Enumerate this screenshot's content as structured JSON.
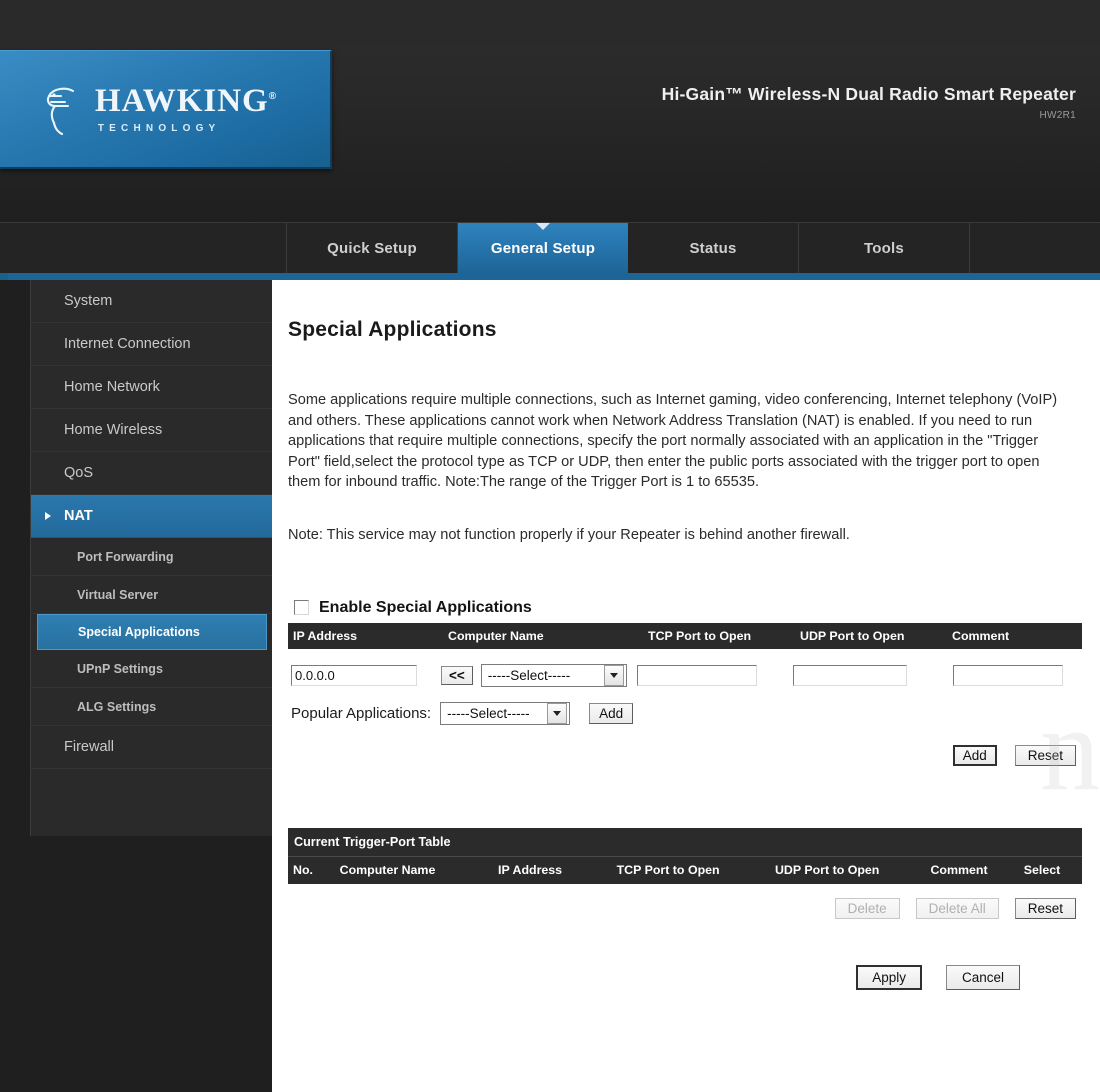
{
  "header": {
    "brand_word": "HAWKING",
    "brand_reg": "®",
    "brand_sub": "TECHNOLOGY",
    "product_title": "Hi-Gain™ Wireless-N Dual Radio Smart Repeater",
    "model": "HW2R1",
    "accent_color": "#1d6596",
    "logo_blue": "#2b7cb4"
  },
  "nav": {
    "tabs": [
      {
        "label": "Quick Setup",
        "active": false
      },
      {
        "label": "General Setup",
        "active": true
      },
      {
        "label": "Status",
        "active": false
      },
      {
        "label": "Tools",
        "active": false
      }
    ]
  },
  "sidebar": {
    "items": [
      {
        "label": "System",
        "active": false
      },
      {
        "label": "Internet Connection",
        "active": false
      },
      {
        "label": "Home Network",
        "active": false
      },
      {
        "label": "Home Wireless",
        "active": false
      },
      {
        "label": "QoS",
        "active": false
      },
      {
        "label": "NAT",
        "active": true
      }
    ],
    "sub_items": [
      {
        "label": "Port Forwarding",
        "active": false
      },
      {
        "label": "Virtual Server",
        "active": false
      },
      {
        "label": "Special Applications",
        "active": true
      },
      {
        "label": "UPnP Settings",
        "active": false
      },
      {
        "label": "ALG Settings",
        "active": false
      }
    ],
    "items_after": [
      {
        "label": "Firewall",
        "active": false
      }
    ]
  },
  "main": {
    "title": "Special Applications",
    "description": "Some applications require multiple connections, such as Internet gaming, video conferencing, Internet telephony (VoIP) and others. These applications cannot work when Network Address Translation (NAT) is enabled. If you need to run applications that require multiple connections, specify the port normally associated with an application in the \"Trigger Port\" field,select the protocol type as TCP or UDP, then enter the public ports associated with the trigger port to open them for inbound traffic. Note:The range of the Trigger Port is 1 to 65535.",
    "note": "Note: This service may not function properly if your Repeater is behind another firewall.",
    "enable_label": "Enable Special Applications",
    "enable_checked": false,
    "entry_table": {
      "columns": [
        "IP Address",
        "Computer Name",
        "TCP Port to Open",
        "UDP Port to Open",
        "Comment"
      ],
      "ip_address_value": "0.0.0.0",
      "copy_button_label": "<<",
      "computer_name_value": "-----Select-----",
      "tcp_port_value": "",
      "udp_port_value": "",
      "comment_value": ""
    },
    "popular": {
      "label": "Popular Applications:",
      "select_value": "-----Select-----",
      "add_label": "Add"
    },
    "form_buttons": {
      "add_label": "Add",
      "reset_label": "Reset"
    },
    "current_table": {
      "section_title": "Current Trigger-Port Table",
      "columns": [
        "No.",
        "Computer Name",
        "IP Address",
        "TCP Port to Open",
        "UDP Port to Open",
        "Comment",
        "Select"
      ],
      "rows": [],
      "delete_label": "Delete",
      "delete_all_label": "Delete All",
      "reset_label": "Reset",
      "delete_disabled": true,
      "delete_all_disabled": true
    },
    "footer_buttons": {
      "apply_label": "Apply",
      "cancel_label": "Cancel"
    }
  }
}
